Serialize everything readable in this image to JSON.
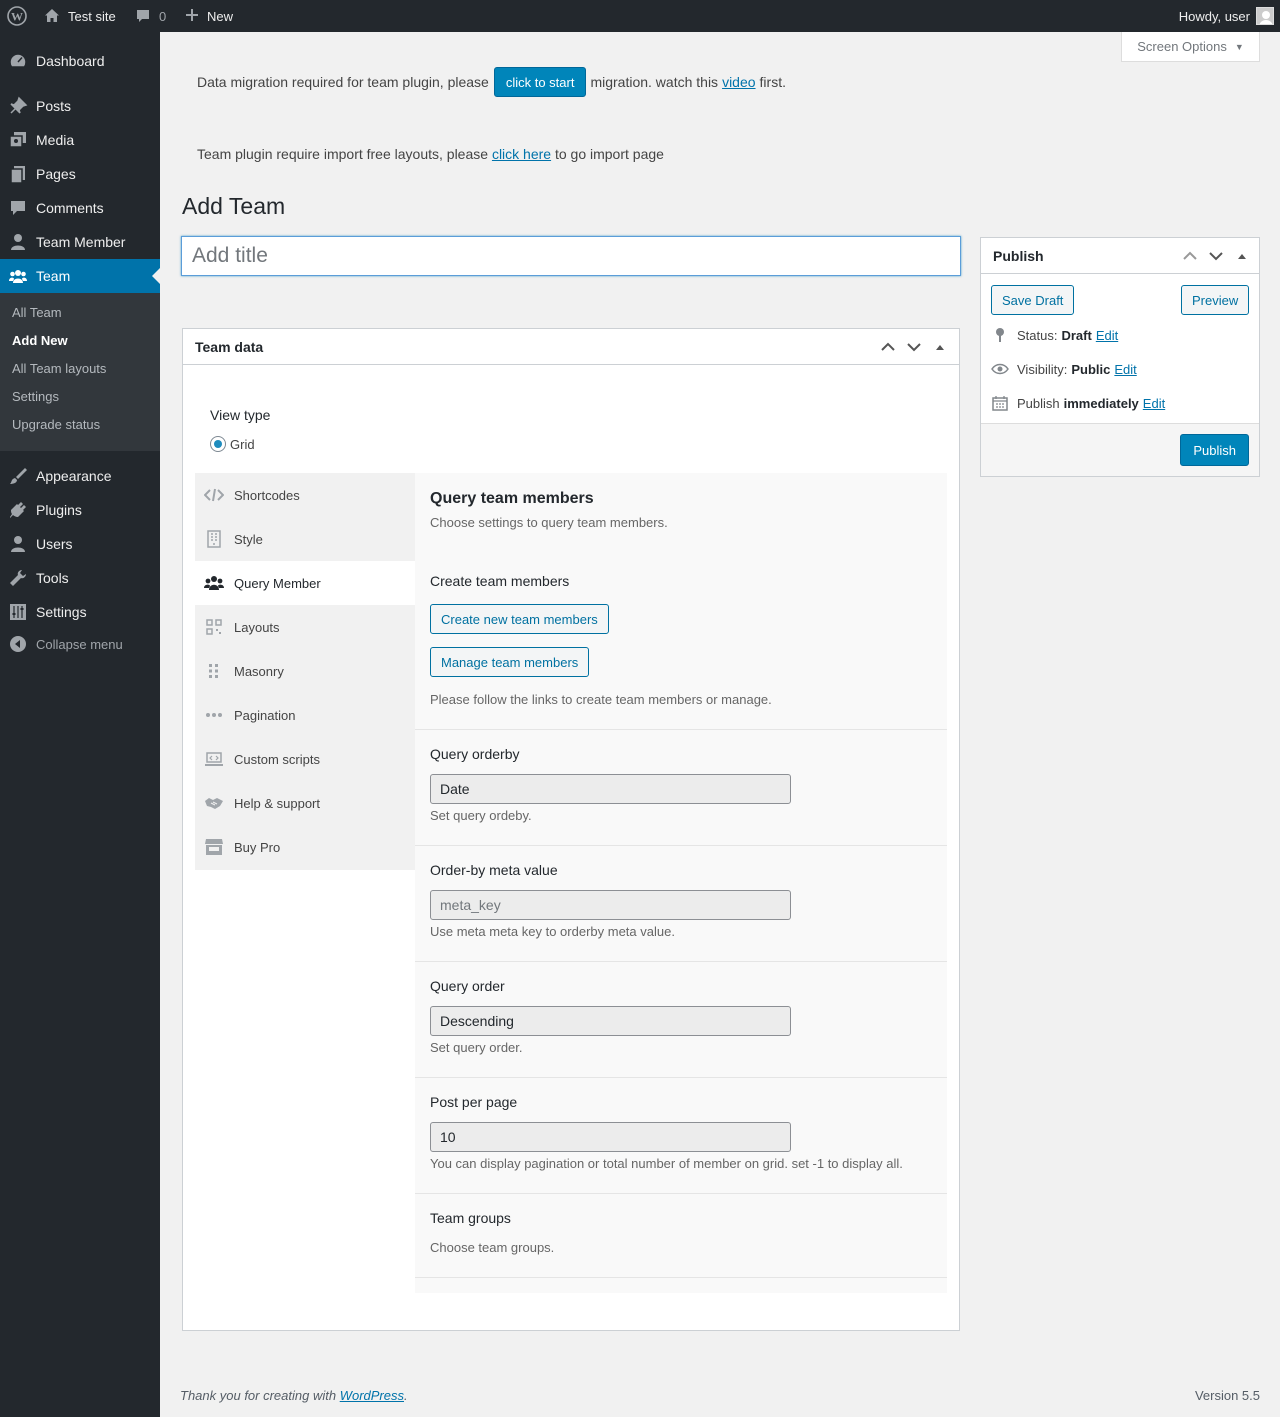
{
  "adminbar": {
    "site_name": "Test site",
    "comments_count": "0",
    "new_label": "New",
    "howdy": "Howdy, user"
  },
  "sidebar": {
    "items": [
      {
        "label": "Dashboard",
        "icon": "dashboard-icon"
      },
      {
        "label": "Posts",
        "icon": "pin-icon"
      },
      {
        "label": "Media",
        "icon": "media-icon"
      },
      {
        "label": "Pages",
        "icon": "pages-icon"
      },
      {
        "label": "Comments",
        "icon": "comment-icon"
      },
      {
        "label": "Team Member",
        "icon": "user-icon"
      },
      {
        "label": "Team",
        "icon": "groups-icon",
        "current": true
      },
      {
        "label": "Appearance",
        "icon": "brush-icon"
      },
      {
        "label": "Plugins",
        "icon": "plug-icon"
      },
      {
        "label": "Users",
        "icon": "users-icon"
      },
      {
        "label": "Tools",
        "icon": "wrench-icon"
      },
      {
        "label": "Settings",
        "icon": "settings-icon"
      },
      {
        "label": "Collapse menu",
        "icon": "collapse-icon"
      }
    ],
    "submenu": [
      "All Team",
      "Add New",
      "All Team layouts",
      "Settings",
      "Upgrade status"
    ],
    "submenu_active": "Add New"
  },
  "notices": {
    "migration_before": "Data migration required for team plugin, please",
    "migration_button": "click to start",
    "migration_after": "migration. watch this",
    "migration_link": "video",
    "migration_end": "first.",
    "import_before": "Team plugin require import free layouts, please",
    "import_link": "click here",
    "import_after": "to go import page"
  },
  "screen_options": "Screen Options",
  "page_title": "Add Team",
  "title_placeholder": "Add title",
  "team_data": {
    "box_title": "Team data",
    "view_type_label": "View type",
    "view_type_option": "Grid",
    "tabs": [
      {
        "label": "Shortcodes",
        "icon": "code-icon"
      },
      {
        "label": "Style",
        "icon": "building-icon"
      },
      {
        "label": "Query Member",
        "icon": "groups-icon",
        "active": true
      },
      {
        "label": "Layouts",
        "icon": "qr-icon"
      },
      {
        "label": "Masonry",
        "icon": "grid-dots-icon"
      },
      {
        "label": "Pagination",
        "icon": "ellipsis-icon"
      },
      {
        "label": "Custom scripts",
        "icon": "laptop-icon"
      },
      {
        "label": "Help & support",
        "icon": "handshake-icon"
      },
      {
        "label": "Buy Pro",
        "icon": "store-icon"
      }
    ],
    "panel": {
      "title": "Query team members",
      "subtitle": "Choose settings to query team members.",
      "create_label": "Create team members",
      "create_button": "Create new team members",
      "manage_button": "Manage team members",
      "create_desc": "Please follow the links to create team members or manage.",
      "orderby_label": "Query orderby",
      "orderby_value": "Date",
      "orderby_desc": "Set query ordeby.",
      "meta_label": "Order-by meta value",
      "meta_placeholder": "meta_key",
      "meta_desc": "Use meta meta key to orderby meta value.",
      "order_label": "Query order",
      "order_value": "Descending",
      "order_desc": "Set query order.",
      "ppp_label": "Post per page",
      "ppp_value": "10",
      "ppp_desc": "You can display pagination or total number of member on grid. set -1 to display all.",
      "groups_label": "Team groups",
      "groups_desc": "Choose team groups."
    }
  },
  "publish": {
    "title": "Publish",
    "save_draft": "Save Draft",
    "preview": "Preview",
    "status_label": "Status:",
    "status_value": "Draft",
    "visibility_label": "Visibility:",
    "visibility_value": "Public",
    "publish_label": "Publish",
    "publish_value": "immediately",
    "edit": "Edit",
    "publish_button": "Publish"
  },
  "footer": {
    "thanks_before": "Thank you for creating with",
    "thanks_link": "WordPress",
    "thanks_after": ".",
    "version": "Version 5.5"
  },
  "colors": {
    "admin_dark": "#23282d",
    "accent": "#0073aa",
    "primary_button": "#0085ba"
  }
}
